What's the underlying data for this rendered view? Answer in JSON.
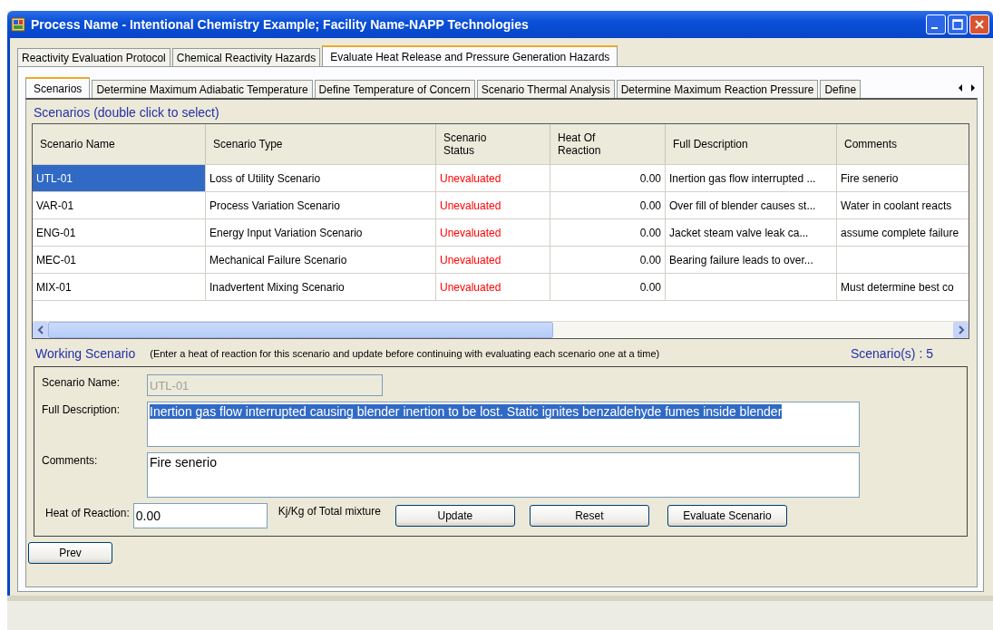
{
  "window": {
    "title": "Process Name - Intentional Chemistry Example; Facility Name-NAPP Technologies"
  },
  "tabs": [
    {
      "label": "Reactivity Evaluation Protocol",
      "selected": false
    },
    {
      "label": "Chemical Reactivity Hazards",
      "selected": false
    },
    {
      "label": "Evaluate Heat Release and Pressure Generation Hazards",
      "selected": true
    }
  ],
  "subtabs": [
    {
      "label": "Scenarios",
      "selected": true
    },
    {
      "label": "Determine Maximum Adiabatic Temperature",
      "selected": false
    },
    {
      "label": "Define Temperature of Concern",
      "selected": false
    },
    {
      "label": "Scenario Thermal Analysis",
      "selected": false
    },
    {
      "label": "Determine Maximum Reaction Pressure",
      "selected": false
    },
    {
      "label": "Define",
      "selected": false
    }
  ],
  "scenarios_title": "Scenarios (double click to select)",
  "table": {
    "columns": [
      "Scenario Name",
      "Scenario Type",
      "Scenario Status",
      "Heat Of Reaction",
      "Full Description",
      "Comments"
    ],
    "rows": [
      {
        "selected": true,
        "cells": [
          "UTL-01",
          "Loss of Utility Scenario",
          "Unevaluated",
          "0.00",
          "Inertion gas flow interrupted ...",
          "Fire senerio"
        ]
      },
      {
        "selected": false,
        "cells": [
          "VAR-01",
          "Process Variation Scenario",
          "Unevaluated",
          "0.00",
          "Over fill of blender causes st...",
          "Water in coolant reacts"
        ]
      },
      {
        "selected": false,
        "cells": [
          "ENG-01",
          "Energy Input Variation Scenario",
          "Unevaluated",
          "0.00",
          "Jacket steam valve leak ca...",
          "assume complete failure"
        ]
      },
      {
        "selected": false,
        "cells": [
          "MEC-01",
          "Mechanical Failure Scenario",
          "Unevaluated",
          "0.00",
          "Bearing failure leads to over...",
          ""
        ]
      },
      {
        "selected": false,
        "cells": [
          "MIX-01",
          "Inadvertent Mixing Scenario",
          "Unevaluated",
          "0.00",
          "",
          "Must determine best co"
        ]
      }
    ]
  },
  "working": {
    "title": "Working Scenario",
    "hint": "(Enter a heat of reaction for this scenario and update before continuing with evaluating each scenario one at a time)",
    "count": "Scenario(s) : 5",
    "name_label": "Scenario Name:",
    "name_value": "UTL-01",
    "desc_label": "Full Description:",
    "desc_value": "Inertion gas flow interrupted causing blender inertion to be lost.  Static ignites benzaldehyde fumes inside blender",
    "comments_label": "Comments:",
    "comments_value": "Fire senerio",
    "heat_label": "Heat of Reaction:",
    "heat_value": "0.00",
    "unit": "Kj/Kg of Total mixture",
    "buttons": [
      "Update",
      "Reset",
      "Evaluate Scenario"
    ]
  },
  "prev_button": "Prev"
}
